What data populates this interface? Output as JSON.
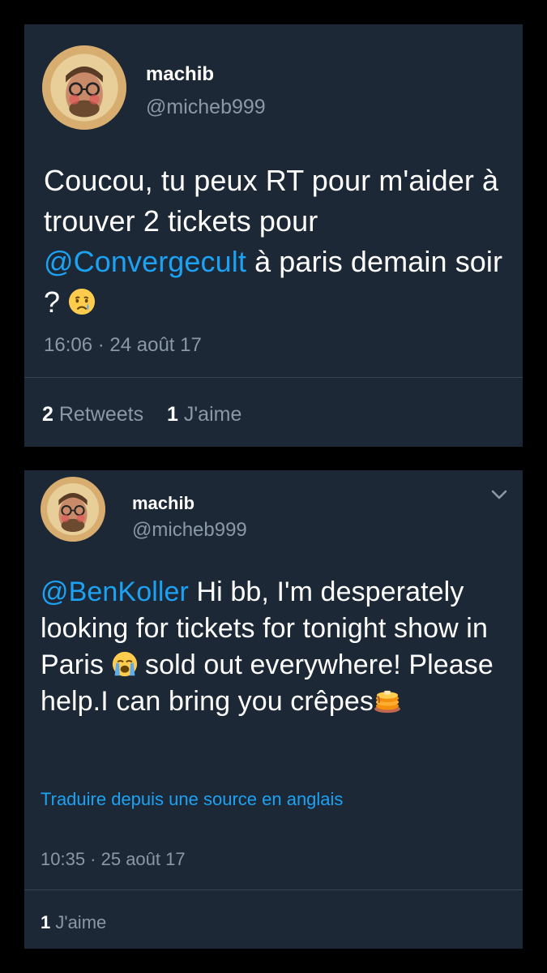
{
  "tweets": [
    {
      "display_name": "machib",
      "handle": "@micheb999",
      "text_before": "Coucou, tu peux RT pour m'aider à trouver 2 tickets pour ",
      "mention": "@Convergecult",
      "text_after": " à paris demain soir ? ",
      "timestamp": "16:06 · 24 août 17",
      "retweets_count": "2",
      "retweets_label": "Retweets",
      "likes_count": "1",
      "likes_label": "J'aime"
    },
    {
      "display_name": "machib",
      "handle": "@micheb999",
      "mention": "@BenKoller",
      "text_part1": " Hi bb, I'm desperately looking for tickets for tonight show in Paris ",
      "text_part2": " sold out everywhere! Please help.I can bring you crêpes",
      "translate_label": "Traduire depuis une source en anglais",
      "timestamp": "10:35 · 25 août 17",
      "likes_count": "1",
      "likes_label": "J'aime"
    }
  ],
  "colors": {
    "background": "#000000",
    "card": "#1c2836",
    "link": "#1da1f2",
    "secondary_text": "#8b98a5"
  }
}
